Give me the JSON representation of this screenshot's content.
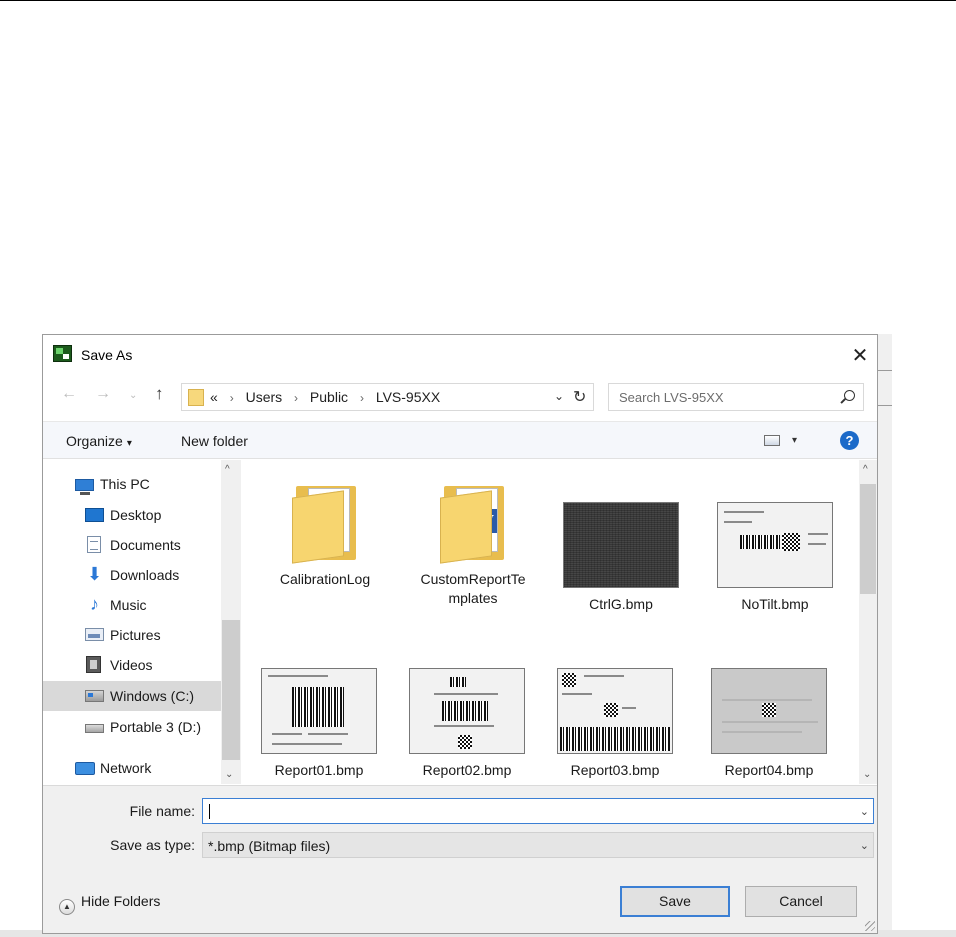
{
  "window": {
    "title": "Save As",
    "close_glyph": "✕"
  },
  "navigation": {
    "back_glyph": "←",
    "forward_glyph": "→",
    "recent_glyph": "⌄",
    "up_glyph": "↑",
    "address": {
      "overflow": "«",
      "crumbs": [
        "Users",
        "Public",
        "LVS-95XX"
      ],
      "dropdown_glyph": "⌄",
      "refresh_glyph": "↻"
    },
    "search": {
      "placeholder": "Search LVS-95XX"
    }
  },
  "toolbar": {
    "organize_label": "Organize",
    "organize_caret": "▾",
    "new_folder_label": "New folder",
    "view_caret": "▾",
    "help_glyph": "?"
  },
  "sidebar": {
    "items": [
      {
        "label": "This PC",
        "icon": "computer-icon"
      },
      {
        "label": "Desktop",
        "icon": "desktop-icon"
      },
      {
        "label": "Documents",
        "icon": "documents-icon"
      },
      {
        "label": "Downloads",
        "icon": "downloads-icon"
      },
      {
        "label": "Music",
        "icon": "music-icon"
      },
      {
        "label": "Pictures",
        "icon": "pictures-icon"
      },
      {
        "label": "Videos",
        "icon": "videos-icon"
      },
      {
        "label": "Windows (C:)",
        "icon": "windows-drive-icon",
        "selected": true
      },
      {
        "label": "Portable 3 (D:)",
        "icon": "drive-icon"
      },
      {
        "label": "Network",
        "icon": "network-icon"
      }
    ],
    "scroll_up": "^",
    "scroll_down": "⌄"
  },
  "files": [
    {
      "name": "CalibrationLog",
      "kind": "folder"
    },
    {
      "name": "CustomReportTemplates",
      "display": "CustomReportTe\nmplates",
      "kind": "folder"
    },
    {
      "name": "CtrlG.bmp",
      "kind": "image"
    },
    {
      "name": "NoTilt.bmp",
      "kind": "image"
    },
    {
      "name": "Report01.bmp",
      "kind": "image"
    },
    {
      "name": "Report02.bmp",
      "kind": "image"
    },
    {
      "name": "Report03.bmp",
      "kind": "image"
    },
    {
      "name": "Report04.bmp",
      "kind": "image"
    }
  ],
  "form": {
    "file_name_label": "File name:",
    "file_name_value": "",
    "save_type_label": "Save as type:",
    "save_type_value": "*.bmp (Bitmap files)",
    "dropdown_glyph": "⌄"
  },
  "footer": {
    "hide_folders_label": "Hide Folders",
    "hide_folders_glyph": "▲",
    "save_label": "Save",
    "cancel_label": "Cancel"
  },
  "colors": {
    "accent": "#3b7fd4",
    "selection": "#d9d9d9",
    "help_blue": "#1b6ac9"
  }
}
